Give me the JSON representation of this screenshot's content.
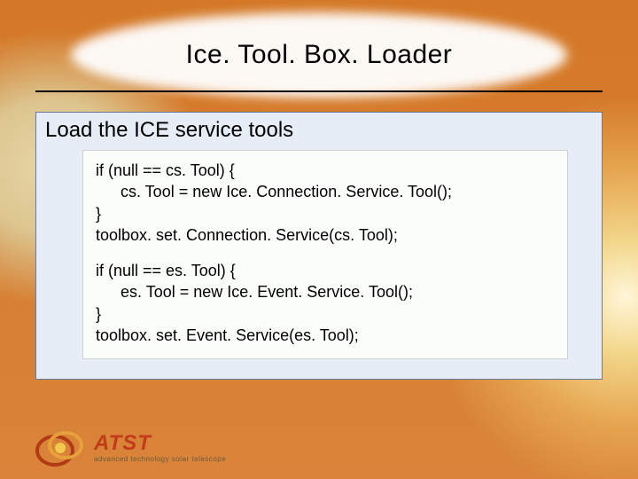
{
  "title": "Ice. Tool. Box. Loader",
  "panel_heading": "Load the ICE service tools",
  "code": {
    "block1": {
      "l1": "if (null == cs. Tool) {",
      "l2": "cs. Tool = new Ice. Connection. Service. Tool();",
      "l3": "}",
      "l4": "toolbox. set. Connection. Service(cs. Tool);"
    },
    "block2": {
      "l1": "if (null == es. Tool) {",
      "l2": "es. Tool = new Ice. Event. Service. Tool();",
      "l3": "}",
      "l4": "toolbox. set. Event. Service(es. Tool);"
    }
  },
  "logo": {
    "main": "ATST",
    "sub": "advanced technology solar telescope"
  }
}
